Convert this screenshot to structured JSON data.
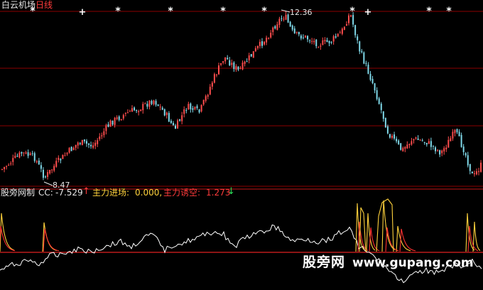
{
  "header": {
    "stock_name": "白云机场",
    "period": "日线"
  },
  "price_labels": {
    "high": "12.36",
    "low": "8.47"
  },
  "indicator": {
    "name": "股旁网制",
    "cc_label": "CC:",
    "cc_value": "-7.529",
    "cc_arrow": "↑",
    "inflow_label": "主力进场:",
    "inflow_value": "0.000,",
    "trap_label": "主力诱空:",
    "trap_value": "1.273",
    "trap_arrow": "↓"
  },
  "watermark": {
    "name": "股旁网",
    "url": "www.gupang.com"
  },
  "colors": {
    "up": "#ff4d4d",
    "down": "#7fd8e8",
    "gridline": "#8b0000",
    "inflow": "#ffd23c",
    "trap": "#ff3030",
    "cc": "#ffffff"
  },
  "markers": {
    "star_glyph": "*",
    "plus_glyph": "+"
  }
}
